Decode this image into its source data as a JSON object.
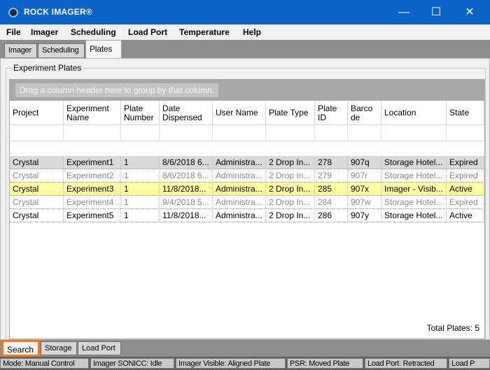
{
  "window": {
    "title": "ROCK IMAGER®",
    "minimize_icon": "minimize-icon",
    "maximize_icon": "maximize-icon",
    "close_icon": "close-icon"
  },
  "menu": [
    "File",
    "Imager",
    "Scheduling",
    "Load Port",
    "Temperature",
    "Help"
  ],
  "top_tabs": [
    "Imager",
    "Scheduling",
    "Plates"
  ],
  "group_title": "Experiment Plates",
  "group_hint": "Drag a column header here to group by that column.",
  "columns": [
    "Project",
    "Experiment Name",
    "Plate Number",
    "Date Dispensed",
    "User Name",
    "Plate Type",
    "Plate ID",
    "Barco de",
    "Location",
    "State"
  ],
  "rows": [
    [
      "Crystal",
      "Experiment1",
      "1",
      "8/6/2018 6...",
      "Administra...",
      "2 Drop In...",
      "278",
      "907q",
      "Storage Hotel...",
      "Expired"
    ],
    [
      "Crystal",
      "Experiment2",
      "1",
      "8/6/2018 6...",
      "Administra...",
      "2 Drop In...",
      "279",
      "907r",
      "Storage Hotel...",
      "Expired"
    ],
    [
      "Crystal",
      "Experiment3",
      "1",
      "11/8/2018...",
      "Administra...",
      "2 Drop In...",
      "285",
      "907x",
      "Imager - Visib...",
      "Active"
    ],
    [
      "Crystal",
      "Experiment4",
      "1",
      "9/4/2018 5...",
      "Administra...",
      "2 Drop In...",
      "284",
      "907w",
      "Storage Hotel...",
      "Expired"
    ],
    [
      "Crystal",
      "Experiment5",
      "1",
      "11/8/2018...",
      "Administra...",
      "2 Drop In...",
      "286",
      "907y",
      "Storage Hotel...",
      "Active"
    ]
  ],
  "totals": {
    "label": "Total Plates:",
    "value": "5"
  },
  "bottom_tabs": [
    "Search",
    "Storage",
    "Load Port"
  ],
  "status": [
    "Mode: Manual Control",
    "Imager SONICC: Idle",
    "Imager Visible: Aligned Plate",
    "PSR: Moved Plate",
    "Load Port: Retracted",
    "Load P"
  ],
  "colors": {
    "titlebar": "#0a63c6",
    "highlight_row": "#ffffa6",
    "selected_tab_border": "#f07a22"
  }
}
